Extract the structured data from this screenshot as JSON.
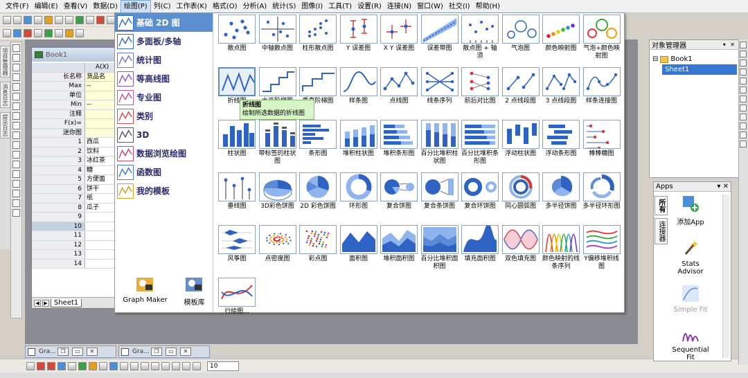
{
  "menubar": {
    "items": [
      "文件(F)",
      "编辑(E)",
      "查看(V)",
      "数据(D)",
      "绘图(P)",
      "列(C)",
      "工作表(K)",
      "格式(O)",
      "分析(A)",
      "统计(S)",
      "图像(I)",
      "工具(T)",
      "设置(R)",
      "连接(N)",
      "窗口(W)",
      "社交(I)",
      "帮助(H)"
    ],
    "active_index": 4
  },
  "book": {
    "title": "Book1",
    "col_header": "A(X)",
    "meta_rows": [
      {
        "label": "长名称",
        "value": "货品名"
      },
      {
        "label": "Max",
        "value": "--"
      },
      {
        "label": "单位",
        "value": ""
      },
      {
        "label": "Min",
        "value": "--"
      },
      {
        "label": "注释",
        "value": ""
      },
      {
        "label": "F(x)=",
        "value": ""
      },
      {
        "label": "迷你图",
        "value": ""
      }
    ],
    "rows": [
      {
        "n": "1",
        "v": "西瓜"
      },
      {
        "n": "2",
        "v": "饮料"
      },
      {
        "n": "3",
        "v": "冰红茶"
      },
      {
        "n": "4",
        "v": "糖"
      },
      {
        "n": "5",
        "v": "方便面"
      },
      {
        "n": "6",
        "v": "饼干"
      },
      {
        "n": "7",
        "v": "纸"
      },
      {
        "n": "8",
        "v": "瓜子"
      },
      {
        "n": "9",
        "v": ""
      },
      {
        "n": "10",
        "v": ""
      },
      {
        "n": "11",
        "v": ""
      },
      {
        "n": "12",
        "v": ""
      },
      {
        "n": "13",
        "v": ""
      },
      {
        "n": "14",
        "v": ""
      }
    ],
    "sheet_tab": "Sheet1"
  },
  "categories": [
    {
      "label": "基础 2D 图",
      "icon": "line-chart-icon"
    },
    {
      "label": "多面板/多轴",
      "icon": "multi-panel-icon"
    },
    {
      "label": "统计图",
      "icon": "histogram-icon"
    },
    {
      "label": "等高线图",
      "icon": "contour-icon"
    },
    {
      "label": "专业图",
      "icon": "polar-icon"
    },
    {
      "label": "类别",
      "icon": "category-icon"
    },
    {
      "label": "3D",
      "icon": "3d-cube-icon"
    },
    {
      "label": "数据浏览绘图",
      "icon": "data-explore-icon"
    },
    {
      "label": "函数图",
      "icon": "function-icon"
    },
    {
      "label": "我的模板",
      "icon": "template-icon"
    }
  ],
  "category_bottom": {
    "graph_maker": "Graph Maker",
    "template_lib": "模板库"
  },
  "gallery": [
    {
      "label": "散点图",
      "type": "scatter"
    },
    {
      "label": "中轴散点图",
      "type": "scatter-axis"
    },
    {
      "label": "柱形散点图",
      "type": "column-scatter"
    },
    {
      "label": "Y 误差图",
      "type": "y-error"
    },
    {
      "label": "X Y 误差图",
      "type": "xy-error"
    },
    {
      "label": "误差带图",
      "type": "error-band"
    },
    {
      "label": "散点图 + 轴须",
      "type": "rug"
    },
    {
      "label": "气泡图",
      "type": "bubble"
    },
    {
      "label": "颜色映射图",
      "type": "color-map"
    },
    {
      "label": "气泡+颜色映射图",
      "type": "bubble-color"
    },
    {
      "label": "折线图",
      "type": "line"
    },
    {
      "label": "水平阶梯图",
      "type": "step-h"
    },
    {
      "label": "垂直阶梯图",
      "type": "step-v"
    },
    {
      "label": "样条图",
      "type": "spline"
    },
    {
      "label": "点线图",
      "type": "line-symbol"
    },
    {
      "label": "线条序列",
      "type": "line-series"
    },
    {
      "label": "前后对比图",
      "type": "before-after"
    },
    {
      "label": "2 点线段图",
      "type": "two-point"
    },
    {
      "label": "3 点线段图",
      "type": "three-point"
    },
    {
      "label": "样条连接图",
      "type": "spline-connect"
    },
    {
      "label": "柱状图",
      "type": "bar"
    },
    {
      "label": "带标签的柱状图",
      "type": "bar-label"
    },
    {
      "label": "条形图",
      "type": "hbar"
    },
    {
      "label": "堆积柱状图",
      "type": "stack-bar"
    },
    {
      "label": "堆积条形图",
      "type": "stack-hbar"
    },
    {
      "label": "百分比堆积柱状图",
      "type": "pct-bar"
    },
    {
      "label": "百分比堆积条形图",
      "type": "pct-hbar"
    },
    {
      "label": "浮动柱状图",
      "type": "float-bar"
    },
    {
      "label": "浮动条形图",
      "type": "float-hbar"
    },
    {
      "label": "棒棒糖图",
      "type": "lollipop"
    },
    {
      "label": "垂线图",
      "type": "drop-line"
    },
    {
      "label": "3D彩色饼图",
      "type": "pie3d"
    },
    {
      "label": "2D 彩色饼图",
      "type": "pie2d"
    },
    {
      "label": "环形图",
      "type": "donut"
    },
    {
      "label": "复合饼图",
      "type": "pie-of-pie"
    },
    {
      "label": "复合条饼图",
      "type": "bar-of-pie"
    },
    {
      "label": "复合环饼图",
      "type": "donut-of-pie"
    },
    {
      "label": "同心圆弧图",
      "type": "concentric"
    },
    {
      "label": "多半径饼图",
      "type": "multi-radius"
    },
    {
      "label": "多半径环形图",
      "type": "multi-radius-donut"
    },
    {
      "label": "风筝图",
      "type": "kite"
    },
    {
      "label": "点密度图",
      "type": "density-dots"
    },
    {
      "label": "彩点图",
      "type": "color-dots"
    },
    {
      "label": "面积图",
      "type": "area"
    },
    {
      "label": "堆积面积图",
      "type": "stack-area"
    },
    {
      "label": "百分比堆积面积图",
      "type": "pct-area"
    },
    {
      "label": "填充面积图",
      "type": "fill-area"
    },
    {
      "label": "双色填充图",
      "type": "two-color"
    },
    {
      "label": "颜色映射的线条序列",
      "type": "color-lines"
    },
    {
      "label": "Y偏移堆积线图",
      "type": "y-offset"
    },
    {
      "label": "行绘图...",
      "type": "plot-by-row"
    }
  ],
  "highlight_index": 10,
  "tooltip": {
    "title": "折线图",
    "desc": "绘制所选数据的折线图"
  },
  "mdi_tabs": [
    "Gra...",
    "Gra..."
  ],
  "font_size": "10",
  "object_manager": {
    "title": "对象管理器",
    "book": "Book1",
    "sheet": "Sheet1"
  },
  "apps": {
    "title": "Apps",
    "tabs": [
      "所有",
      "连接器"
    ],
    "items": [
      "添加App",
      "Stats Advisor",
      "Simple Fit",
      "Sequential Fit"
    ]
  }
}
